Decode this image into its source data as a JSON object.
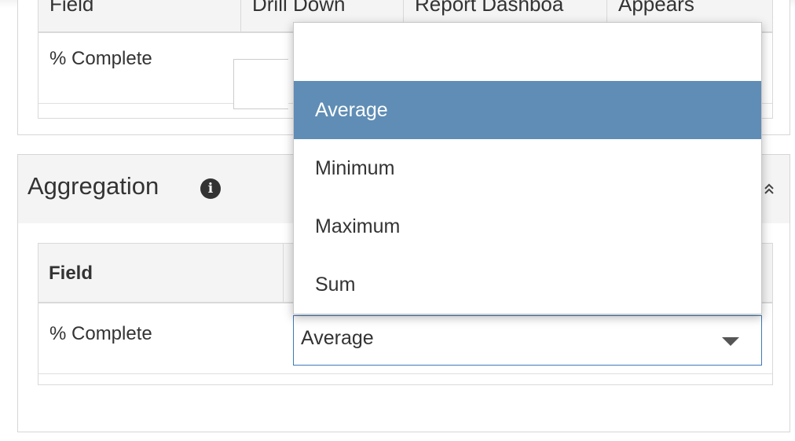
{
  "top_table": {
    "headers": [
      "Field",
      "Drill Down",
      "Report Dashboa",
      "Appears"
    ],
    "row_field": "% Complete"
  },
  "aggregation": {
    "title": "Aggregation",
    "info_icon": "info-circle-icon",
    "collapse_icon": "double-chevron-up-icon",
    "table": {
      "field_header": "Field",
      "row_field": "% Complete",
      "select_value": "Average"
    }
  },
  "dropdown": {
    "options": [
      "Average",
      "Minimum",
      "Maximum",
      "Sum"
    ],
    "selected": "Average"
  },
  "colors": {
    "selected_option_bg": "#5f8db5",
    "select_border": "#3f7ab6"
  }
}
